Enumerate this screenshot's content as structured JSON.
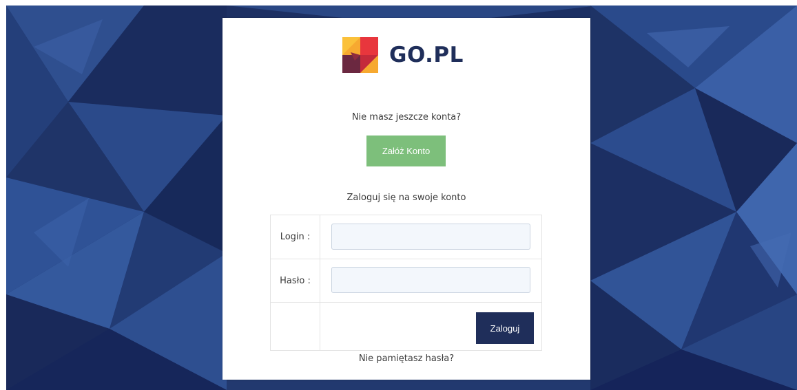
{
  "brand": {
    "name": "GO.PL",
    "logo_icon": "go-pl-square-logo",
    "text_color": "#1f2e5a"
  },
  "register": {
    "prompt": "Nie masz jeszcze konta?",
    "button_label": "Załóż Konto",
    "button_color": "#7dbf7b"
  },
  "login": {
    "prompt": "Zaloguj się na swoje konto",
    "login_label": "Login :",
    "login_value": "",
    "password_label": "Hasło :",
    "password_value": "",
    "submit_label": "Zaloguj",
    "submit_color": "#1f2e5a",
    "forgot_link": "Nie pamiętasz hasła?"
  },
  "background": {
    "style": "dark-blue-low-poly",
    "base_color": "#1a2d5c"
  }
}
